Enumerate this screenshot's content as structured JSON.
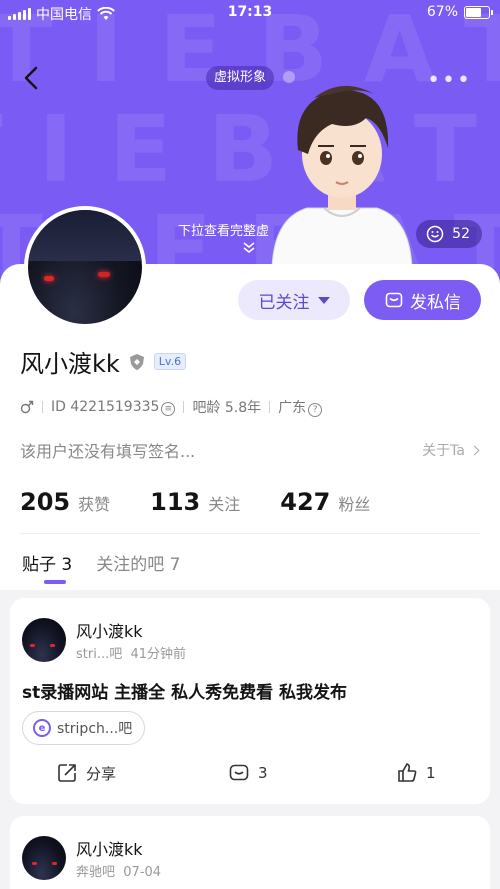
{
  "status_bar": {
    "carrier": "中国电信",
    "time": "17:13",
    "battery": "67%",
    "battery_level": 0.67
  },
  "header": {
    "watermark": "TIEBATIEBA",
    "avatar_tag": "虚拟形象",
    "pulldown_hint": "下拉查看完整虚",
    "likes_count": "52"
  },
  "profile": {
    "follow_label": "已关注",
    "message_label": "发私信",
    "username": "风小渡kk",
    "level": "Lv.6",
    "id_text": "ID 4221519335",
    "bar_age": "吧龄 5.8年",
    "location": "广东",
    "signature": "该用户还没有填写签名...",
    "about": "关于Ta"
  },
  "stats": [
    {
      "value": "205",
      "label": "获赞"
    },
    {
      "value": "113",
      "label": "关注"
    },
    {
      "value": "427",
      "label": "粉丝"
    }
  ],
  "tabs": [
    {
      "label": "贴子",
      "count": "3"
    },
    {
      "label": "关注的吧",
      "count": "7"
    }
  ],
  "posts": [
    {
      "author": "风小渡kk",
      "forum_short": "stri...吧",
      "time": "41分钟前",
      "title": "st录播网站 主播全 私人秀免费看 私我发布",
      "forum_tag": "stripch...吧",
      "share_label": "分享",
      "comments": "3",
      "likes": "1"
    },
    {
      "author": "风小渡kk",
      "forum_short": "奔驰吧",
      "time": "07-04"
    }
  ],
  "colors": {
    "accent": "#7c5cf2",
    "header_bg": "#7a5cf5"
  }
}
